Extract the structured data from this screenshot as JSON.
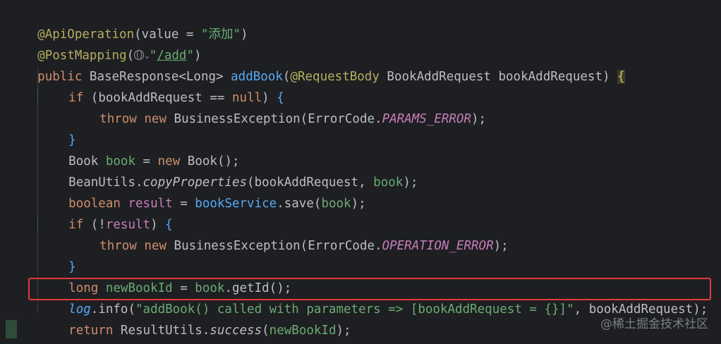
{
  "code": {
    "l1": {
      "annotation": "@ApiOperation",
      "open": "(",
      "key": "value",
      "eq": " = ",
      "str": "\"添加\"",
      "close": ")"
    },
    "l2": {
      "annotation": "@PostMapping",
      "open": "(",
      "str_open": "\"",
      "url": "/add",
      "str_close": "\"",
      "close": ")"
    },
    "l3": {
      "kw_public": "public",
      "type": "BaseResponse",
      "generic": "<Long>",
      "method": "addBook",
      "open": "(",
      "anno": "@RequestBody",
      "ptype": "BookAddRequest",
      "pname": "bookAddRequest",
      "close": ")",
      "brace": "{"
    },
    "l4": {
      "kw_if": "if",
      "open": "(",
      "var": "bookAddRequest",
      "op": " == ",
      "kw_null": "null",
      "close": ")",
      "brace": "{"
    },
    "l5": {
      "kw_throw": "throw",
      "kw_new": "new",
      "cls": "BusinessException",
      "open": "(",
      "enum": "ErrorCode.",
      "const": "PARAMS_ERROR",
      "close": ");"
    },
    "l6": {
      "brace": "}"
    },
    "l7": {
      "type": "Book",
      "var": "book",
      "eq": " = ",
      "kw_new": "new",
      "ctor": "Book",
      "end": "();"
    },
    "l8": {
      "cls": "BeanUtils.",
      "method": "copyProperties",
      "open": "(",
      "arg1": "bookAddRequest",
      "sep": ", ",
      "arg2": "book",
      "close": ");"
    },
    "l9": {
      "kw_boolean": "boolean",
      "var": "result",
      "eq": " = ",
      "svc": "bookService",
      "dot": ".save",
      "open": "(",
      "arg": "book",
      "close": ");"
    },
    "l10": {
      "kw_if": "if",
      "open": "(!",
      "var": "result",
      "close": ")",
      "brace": "{"
    },
    "l11": {
      "kw_throw": "throw",
      "kw_new": "new",
      "cls": "BusinessException",
      "open": "(",
      "enum": "ErrorCode.",
      "const": "OPERATION_ERROR",
      "close": ");"
    },
    "l12": {
      "brace": "}"
    },
    "l13": {
      "kw_long": "long",
      "var": "newBookId",
      "eq": " = ",
      "obj": "book",
      "call": ".getId",
      "end": "();"
    },
    "l14": {
      "log": "log",
      "call": ".info",
      "open": "(",
      "str": "\"addBook() called with parameters => [bookAddRequest = {}]\"",
      "sep": ", ",
      "arg": "bookAddRequest",
      "close": ");"
    },
    "l15": {
      "kw_return": "return",
      "cls": "ResultUtils.",
      "method": "success",
      "open": "(",
      "arg": "newBookId",
      "close": ");"
    },
    "l16": {
      "brace": "}"
    }
  },
  "watermark": "@稀土掘金技术社区",
  "colors": {
    "background": "#1e1f22",
    "keyword": "#cf8e6d",
    "string": "#6aab73",
    "annotation": "#b3ae60",
    "method": "#56a8f5",
    "constant": "#c77dbb",
    "highlight_box": "#e23a3a"
  },
  "icons": {
    "url_inlay": "globe-icon",
    "url_chevron": "chevron-down-icon"
  }
}
